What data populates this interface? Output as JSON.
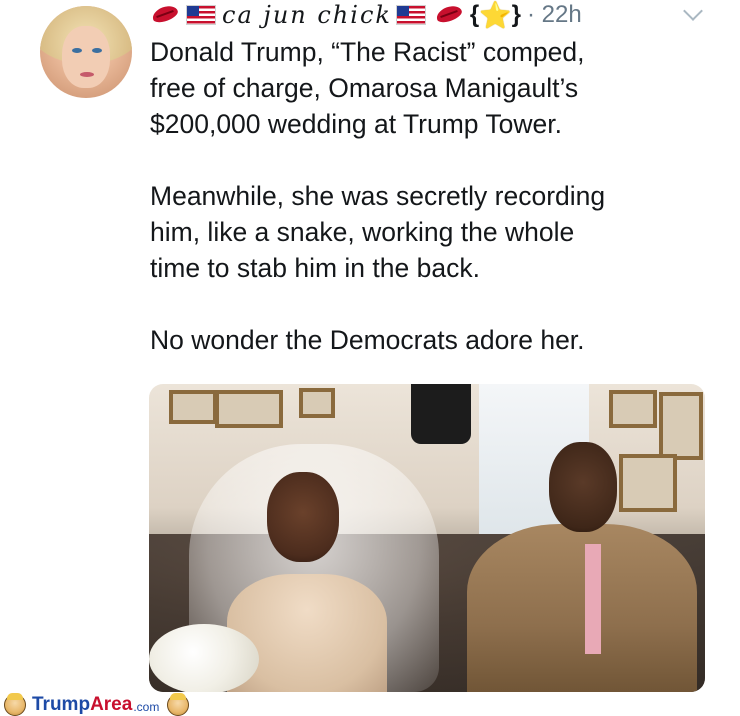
{
  "header": {
    "display_name": "ca jun chick",
    "brace_open": "{",
    "brace_close": "}",
    "star_glyph": "⭐",
    "timestamp": "· 22h",
    "icons": [
      "lips-icon",
      "us-flag-icon",
      "us-flag-icon",
      "lips-icon",
      "star-icon",
      "chevron-down-icon"
    ]
  },
  "tweet": {
    "paragraphs": [
      "Donald Trump, “The Racist” comped,\nfree of charge, Omarosa Manigault’s\n$200,000 wedding at Trump Tower.",
      "Meanwhile, she was secretly recording\nhim,  like a snake, working the whole\ntime to stab him in the back.",
      "No wonder the Democrats adore her."
    ]
  },
  "watermark": {
    "part1": "Trump",
    "part2": "Area",
    "part3": ".com"
  },
  "colors": {
    "text": "#14171a",
    "muted": "#657786",
    "logo_blue": "#1d4aa6",
    "logo_red": "#c8102e"
  }
}
